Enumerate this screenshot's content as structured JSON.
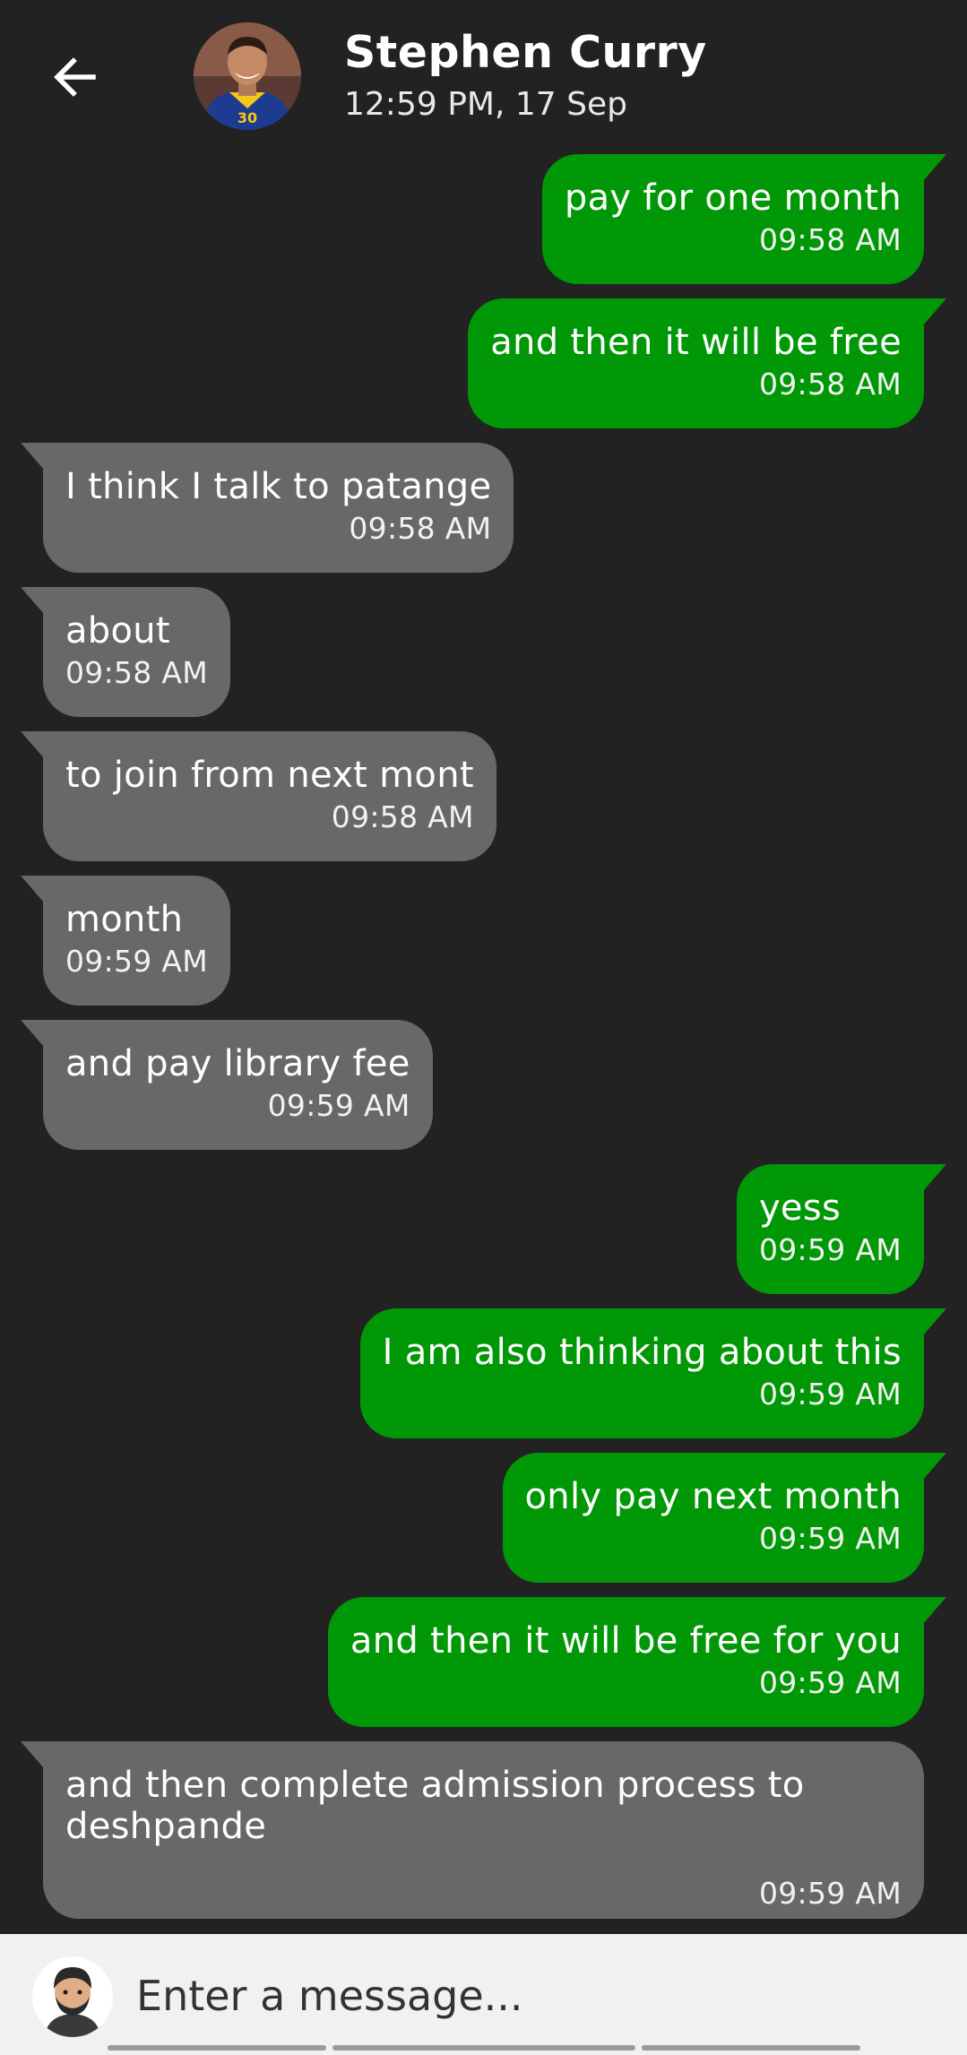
{
  "header": {
    "back_icon": "arrow-left-icon",
    "avatar_icon": "contact-avatar",
    "name": "Stephen Curry",
    "last_seen": "12:59 PM, 17 Sep"
  },
  "colors": {
    "background": "#222222",
    "sent_bubble": "#009806",
    "received_bubble": "#686868",
    "composer_bg": "#f1f1f1"
  },
  "messages": [
    {
      "direction": "sent",
      "text": "pay for one month",
      "time": "09:58 AM"
    },
    {
      "direction": "sent",
      "text": "and then it will be free",
      "time": "09:58 AM"
    },
    {
      "direction": "received",
      "text": "I think I talk to patange",
      "time": "09:58 AM"
    },
    {
      "direction": "received",
      "text": "about",
      "time": "09:58 AM"
    },
    {
      "direction": "received",
      "text": "to join from next mont",
      "time": "09:58 AM"
    },
    {
      "direction": "received",
      "text": "month",
      "time": "09:59 AM"
    },
    {
      "direction": "received",
      "text": "and pay library fee",
      "time": "09:59 AM"
    },
    {
      "direction": "sent",
      "text": "yess",
      "time": "09:59 AM"
    },
    {
      "direction": "sent",
      "text": "I am also thinking about this",
      "time": "09:59 AM"
    },
    {
      "direction": "sent",
      "text": "only pay next month",
      "time": "09:59 AM"
    },
    {
      "direction": "sent",
      "text": "and then it will be free for you",
      "time": "09:59 AM"
    },
    {
      "direction": "received",
      "text": "and then complete admission process to deshpande",
      "time": "09:59 AM"
    }
  ],
  "composer": {
    "avatar_icon": "user-avatar",
    "placeholder": "Enter a message..."
  }
}
